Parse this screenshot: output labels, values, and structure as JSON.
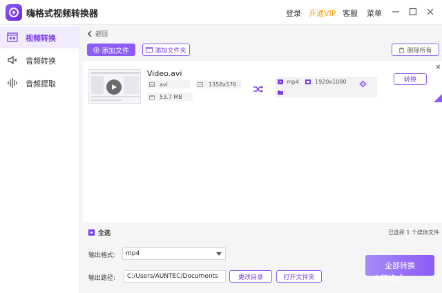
{
  "app": {
    "title": "嗨格式视频转换器"
  },
  "titlebar": {
    "login": "登录",
    "vip": "开通VIP",
    "service": "客服",
    "menu": "菜单"
  },
  "sidebar": {
    "items": [
      {
        "label": "视频转换",
        "icon": "video-convert-icon",
        "active": true
      },
      {
        "label": "音频转换",
        "icon": "audio-convert-icon",
        "active": false
      },
      {
        "label": "音频提取",
        "icon": "audio-extract-icon",
        "active": false
      }
    ]
  },
  "toolbar": {
    "back": "返回",
    "add_file": "添加文件",
    "add_folder": "添加文件夹",
    "delete_all": "删除所有"
  },
  "file": {
    "name": "Video.avi",
    "format": "avi",
    "resolution": "1358x576",
    "size": "53.7 MB",
    "output_format": "mp4",
    "output_resolution": "1920x1080",
    "convert": "转换"
  },
  "bottom": {
    "select_all": "全选",
    "selected_info": "已选择 1 个媒体文件",
    "output_format_label": "输出格式:",
    "output_format_value": "mp4",
    "output_path_label": "输出路径:",
    "output_path_value": "C:/Users/AUNTEC/Documents",
    "change_dir": "更改目录",
    "open_folder": "打开文件夹",
    "convert_all": "全部转换"
  },
  "watermark": "@嗨格式",
  "colors": {
    "accent": "#8b5cf6",
    "accent_dark": "#7c3aed",
    "vip": "#f59e0b",
    "sidebar_active_bg": "#f1ecfd"
  }
}
